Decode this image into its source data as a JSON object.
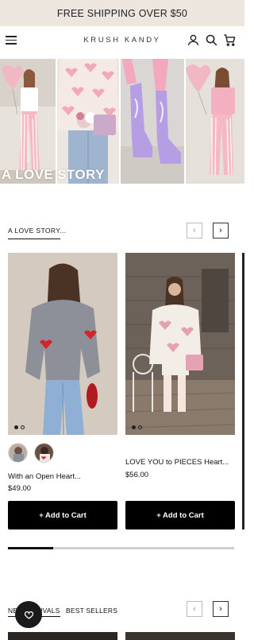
{
  "announcement": "FREE SHIPPING OVER $50",
  "header": {
    "logo": "KRUSH KANDY"
  },
  "hero": {
    "overlay_text": "A LOVE STORY"
  },
  "section": {
    "title": "A LOVE STORY..."
  },
  "products": [
    {
      "title": "With an Open Heart...",
      "price": "$49.00",
      "add_to_cart": "+ Add to Cart"
    },
    {
      "title": "LOVE YOU to PIECES Heart...",
      "price": "$56.00",
      "add_to_cart": "+ Add to Cart"
    }
  ],
  "carousel": {
    "progress": 0.2
  },
  "tabs": {
    "new_arrivals": "NEW ARRIVALS",
    "best_sellers": "BEST SELLERS"
  },
  "colors": {
    "announcement_bg": "#ece6df",
    "button_bg": "#000000"
  }
}
